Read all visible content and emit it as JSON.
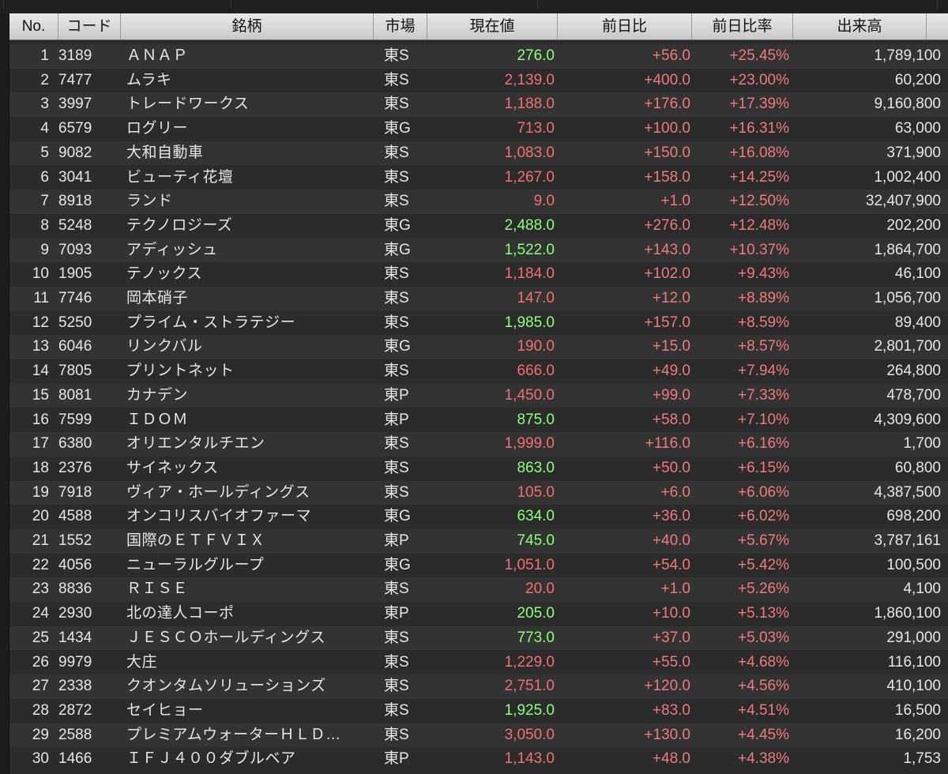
{
  "table": {
    "headers": [
      "No.",
      "コード",
      "銘柄",
      "市場",
      "現在値",
      "前日比",
      "前日比率",
      "出来高"
    ],
    "rows": [
      {
        "no": "1",
        "code": "3189",
        "name": "ＡＮＡＰ",
        "market": "東S",
        "price": "276.0",
        "price_color": "green",
        "change": "+56.0",
        "pct": "+25.45%",
        "volume": "1,789,100"
      },
      {
        "no": "2",
        "code": "7477",
        "name": "ムラキ",
        "market": "東S",
        "price": "2,139.0",
        "price_color": "red",
        "change": "+400.0",
        "pct": "+23.00%",
        "volume": "60,200"
      },
      {
        "no": "3",
        "code": "3997",
        "name": "トレードワークス",
        "market": "東S",
        "price": "1,188.0",
        "price_color": "red",
        "change": "+176.0",
        "pct": "+17.39%",
        "volume": "9,160,800"
      },
      {
        "no": "4",
        "code": "6579",
        "name": "ログリー",
        "market": "東G",
        "price": "713.0",
        "price_color": "red",
        "change": "+100.0",
        "pct": "+16.31%",
        "volume": "63,000"
      },
      {
        "no": "5",
        "code": "9082",
        "name": "大和自動車",
        "market": "東S",
        "price": "1,083.0",
        "price_color": "red",
        "change": "+150.0",
        "pct": "+16.08%",
        "volume": "371,900"
      },
      {
        "no": "6",
        "code": "3041",
        "name": "ビューティ花壇",
        "market": "東S",
        "price": "1,267.0",
        "price_color": "red",
        "change": "+158.0",
        "pct": "+14.25%",
        "volume": "1,002,400"
      },
      {
        "no": "7",
        "code": "8918",
        "name": "ランド",
        "market": "東S",
        "price": "9.0",
        "price_color": "red",
        "change": "+1.0",
        "pct": "+12.50%",
        "volume": "32,407,900"
      },
      {
        "no": "8",
        "code": "5248",
        "name": "テクノロジーズ",
        "market": "東G",
        "price": "2,488.0",
        "price_color": "green",
        "change": "+276.0",
        "pct": "+12.48%",
        "volume": "202,200"
      },
      {
        "no": "9",
        "code": "7093",
        "name": "アディッシュ",
        "market": "東G",
        "price": "1,522.0",
        "price_color": "green",
        "change": "+143.0",
        "pct": "+10.37%",
        "volume": "1,864,700"
      },
      {
        "no": "10",
        "code": "1905",
        "name": "テノックス",
        "market": "東S",
        "price": "1,184.0",
        "price_color": "red",
        "change": "+102.0",
        "pct": "+9.43%",
        "volume": "46,100"
      },
      {
        "no": "11",
        "code": "7746",
        "name": "岡本硝子",
        "market": "東S",
        "price": "147.0",
        "price_color": "red",
        "change": "+12.0",
        "pct": "+8.89%",
        "volume": "1,056,700"
      },
      {
        "no": "12",
        "code": "5250",
        "name": "プライム・ストラテジー",
        "market": "東S",
        "price": "1,985.0",
        "price_color": "green",
        "change": "+157.0",
        "pct": "+8.59%",
        "volume": "89,400"
      },
      {
        "no": "13",
        "code": "6046",
        "name": "リンクバル",
        "market": "東G",
        "price": "190.0",
        "price_color": "red",
        "change": "+15.0",
        "pct": "+8.57%",
        "volume": "2,801,700"
      },
      {
        "no": "14",
        "code": "7805",
        "name": "プリントネット",
        "market": "東S",
        "price": "666.0",
        "price_color": "red",
        "change": "+49.0",
        "pct": "+7.94%",
        "volume": "264,800"
      },
      {
        "no": "15",
        "code": "8081",
        "name": "カナデン",
        "market": "東P",
        "price": "1,450.0",
        "price_color": "red",
        "change": "+99.0",
        "pct": "+7.33%",
        "volume": "478,700"
      },
      {
        "no": "16",
        "code": "7599",
        "name": "ＩＤＯＭ",
        "market": "東P",
        "price": "875.0",
        "price_color": "green",
        "change": "+58.0",
        "pct": "+7.10%",
        "volume": "4,309,600"
      },
      {
        "no": "17",
        "code": "6380",
        "name": "オリエンタルチエン",
        "market": "東S",
        "price": "1,999.0",
        "price_color": "red",
        "change": "+116.0",
        "pct": "+6.16%",
        "volume": "1,700"
      },
      {
        "no": "18",
        "code": "2376",
        "name": "サイネックス",
        "market": "東S",
        "price": "863.0",
        "price_color": "green",
        "change": "+50.0",
        "pct": "+6.15%",
        "volume": "60,800"
      },
      {
        "no": "19",
        "code": "7918",
        "name": "ヴィア・ホールディングス",
        "market": "東S",
        "price": "105.0",
        "price_color": "red",
        "change": "+6.0",
        "pct": "+6.06%",
        "volume": "4,387,500"
      },
      {
        "no": "20",
        "code": "4588",
        "name": "オンコリスバイオファーマ",
        "market": "東G",
        "price": "634.0",
        "price_color": "green",
        "change": "+36.0",
        "pct": "+6.02%",
        "volume": "698,200"
      },
      {
        "no": "21",
        "code": "1552",
        "name": "国際のＥＴＦＶＩＸ",
        "market": "東P",
        "price": "745.0",
        "price_color": "green",
        "change": "+40.0",
        "pct": "+5.67%",
        "volume": "3,787,161"
      },
      {
        "no": "22",
        "code": "4056",
        "name": "ニューラルグループ",
        "market": "東G",
        "price": "1,051.0",
        "price_color": "red",
        "change": "+54.0",
        "pct": "+5.42%",
        "volume": "100,500"
      },
      {
        "no": "23",
        "code": "8836",
        "name": "ＲＩＳＥ",
        "market": "東S",
        "price": "20.0",
        "price_color": "red",
        "change": "+1.0",
        "pct": "+5.26%",
        "volume": "4,100"
      },
      {
        "no": "24",
        "code": "2930",
        "name": "北の達人コーポ",
        "market": "東P",
        "price": "205.0",
        "price_color": "green",
        "change": "+10.0",
        "pct": "+5.13%",
        "volume": "1,860,100"
      },
      {
        "no": "25",
        "code": "1434",
        "name": "ＪＥＳＣＯホールディングス",
        "market": "東S",
        "price": "773.0",
        "price_color": "green",
        "change": "+37.0",
        "pct": "+5.03%",
        "volume": "291,000"
      },
      {
        "no": "26",
        "code": "9979",
        "name": "大庄",
        "market": "東S",
        "price": "1,229.0",
        "price_color": "red",
        "change": "+55.0",
        "pct": "+4.68%",
        "volume": "116,100"
      },
      {
        "no": "27",
        "code": "2338",
        "name": "クオンタムソリューションズ",
        "market": "東S",
        "price": "2,751.0",
        "price_color": "red",
        "change": "+120.0",
        "pct": "+4.56%",
        "volume": "410,100"
      },
      {
        "no": "28",
        "code": "2872",
        "name": "セイヒョー",
        "market": "東S",
        "price": "1,925.0",
        "price_color": "green",
        "change": "+83.0",
        "pct": "+4.51%",
        "volume": "16,500"
      },
      {
        "no": "29",
        "code": "2588",
        "name": "プレミアムウォーターＨＬＤ…",
        "market": "東S",
        "price": "3,050.0",
        "price_color": "red",
        "change": "+130.0",
        "pct": "+4.45%",
        "volume": "16,200"
      },
      {
        "no": "30",
        "code": "1466",
        "name": "ＩＦＪ４００ダブルベア",
        "market": "東P",
        "price": "1,143.0",
        "price_color": "red",
        "change": "+48.0",
        "pct": "+4.38%",
        "volume": "1,753"
      }
    ]
  },
  "colors": {
    "price_red": "#f36f6f",
    "price_green": "#8dff7a",
    "change_red": "#f07a7a",
    "row_odd": "#333333",
    "row_even": "#2b2b2b",
    "header_bg": "#d9d9d9"
  }
}
